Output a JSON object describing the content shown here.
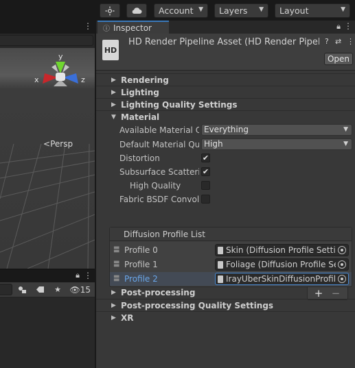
{
  "toolbar": {
    "account_label": "Account",
    "layers_label": "Layers",
    "layout_label": "Layout"
  },
  "scene": {
    "gizmo": {
      "y": "y",
      "x": "x",
      "z": "z",
      "persp": "Persp"
    }
  },
  "hierarchy": {
    "count": "15"
  },
  "inspector": {
    "tab_label": "Inspector",
    "asset_title": "HD Render Pipeline Asset (HD Render Pipeline Asset)",
    "asset_icon_text": "HD",
    "open_label": "Open",
    "sections": {
      "rendering": "Rendering",
      "lighting": "Lighting",
      "lighting_quality": "Lighting Quality Settings",
      "material": "Material",
      "post_processing": "Post-processing",
      "post_processing_quality": "Post-processing Quality Settings",
      "xr": "XR"
    },
    "material": {
      "available_quality_label": "Available Material Quality Levels",
      "available_quality_value": "Everything",
      "default_quality_label": "Default Material Quality Level",
      "default_quality_value": "High",
      "distortion_label": "Distortion",
      "distortion_checked": true,
      "sss_label": "Subsurface Scattering",
      "sss_checked": true,
      "high_quality_label": "High Quality",
      "high_quality_checked": false,
      "fabric_label": "Fabric BSDF Convolution",
      "fabric_checked": false,
      "diffusion_list": {
        "header": "Diffusion Profile List",
        "profiles": [
          {
            "name": "Profile 0",
            "value": "Skin (Diffusion Profile Settings)"
          },
          {
            "name": "Profile 1",
            "value": "Foliage (Diffusion Profile Settings)"
          },
          {
            "name": "Profile 2",
            "value": "IrayUberSkinDiffusionProfile"
          }
        ],
        "add_label": "+",
        "remove_label": "−"
      }
    }
  },
  "colors": {
    "accent": "#3a79bb",
    "selected_text": "#6aa6e8",
    "gizmo_y": "#6fd62f",
    "gizmo_x": "#c8272b",
    "gizmo_z": "#3a6fd8"
  }
}
